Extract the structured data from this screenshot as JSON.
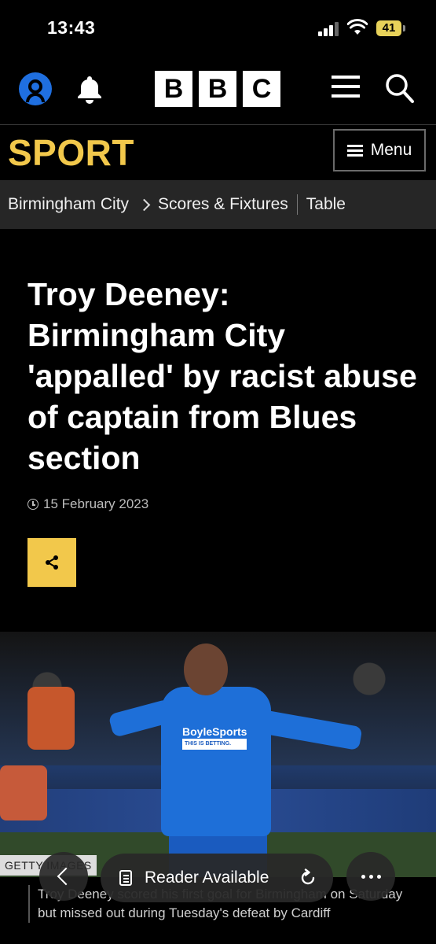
{
  "status_bar": {
    "time": "13:43",
    "battery": "41"
  },
  "header": {
    "logo_letters": [
      "B",
      "B",
      "C"
    ]
  },
  "sport_bar": {
    "title": "SPORT",
    "menu_label": "Menu"
  },
  "breadcrumb": {
    "team": "Birmingham City",
    "scores": "Scores & Fixtures",
    "table": "Table"
  },
  "article": {
    "headline": "Troy Deeney: Birmingham City 'appalled' by racist abuse of captain from Blues section",
    "date": "15 February 2023",
    "image_credit": "GETTY IMAGES",
    "shirt_sponsor": "BoyleSports",
    "shirt_tagline": "THIS IS BETTING.",
    "caption": "Troy Deeney scored his first goal for Birmingham on Saturday but missed out during Tuesday's defeat by Cardiff"
  },
  "browser": {
    "reader_label": "Reader Available"
  },
  "colors": {
    "sport_yellow": "#f2c84b",
    "account_blue": "#1f6fe0",
    "battery": "#e8d25a"
  }
}
